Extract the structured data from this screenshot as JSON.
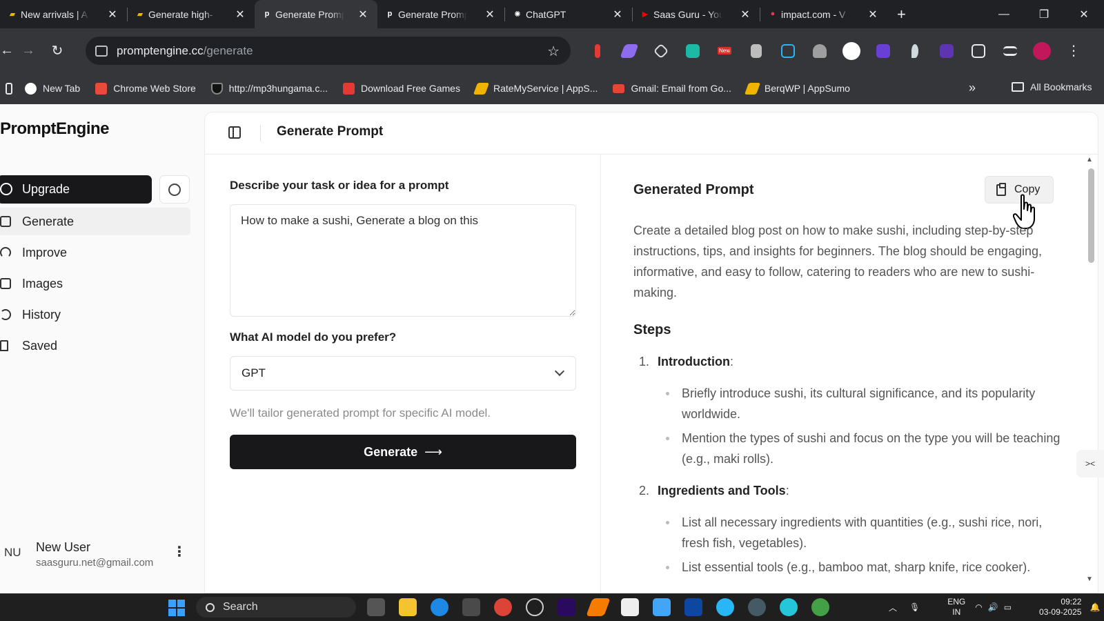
{
  "browser": {
    "tabs": [
      {
        "title": "New arrivals | A",
        "favicon": "aws-icon",
        "color": "#f0b400"
      },
      {
        "title": "Generate high-",
        "favicon": "appsumo-icon",
        "color": "#f0b400"
      },
      {
        "title": "Generate Promp",
        "favicon": "p",
        "active": true
      },
      {
        "title": "Generate Promp",
        "favicon": "p"
      },
      {
        "title": "ChatGPT",
        "favicon": "openai-icon"
      },
      {
        "title": "Saas Guru - You",
        "favicon": "youtube-icon",
        "color": "#ff0000"
      },
      {
        "title": "impact.com - V",
        "favicon": "impact-icon",
        "color": "#e53950"
      }
    ],
    "url_host": "promptengine.cc",
    "url_path": "/generate",
    "ext_new_badge": "New",
    "bookmarks": [
      {
        "label": "New Tab",
        "color": "#ffffff"
      },
      {
        "label": "Chrome Web Store",
        "color": "#e84a3c"
      },
      {
        "label": "http://mp3hungama.c...",
        "color": "#111111"
      },
      {
        "label": "Download Free Games",
        "color": "#e53935"
      },
      {
        "label": "RateMyService | AppS...",
        "color": "#f0b400"
      },
      {
        "label": "Gmail: Email from Go...",
        "color": "#ea4335"
      },
      {
        "label": "BerqWP | AppSumo",
        "color": "#f0b400"
      }
    ],
    "all_bookmarks": "All Bookmarks"
  },
  "sidebar": {
    "logo": "PromptEngine",
    "upgrade": "Upgrade",
    "items": [
      {
        "label": "Generate",
        "icon": "square-chevron-icon",
        "active": true
      },
      {
        "label": "Improve",
        "icon": "gauge-icon"
      },
      {
        "label": "Images",
        "icon": "image-icon"
      },
      {
        "label": "History",
        "icon": "history-icon"
      },
      {
        "label": "Saved",
        "icon": "bookmark-icon"
      }
    ],
    "user": {
      "initials": "NU",
      "name": "New User",
      "email": "saasguru.net@gmail.com"
    }
  },
  "header": {
    "title": "Generate Prompt"
  },
  "form": {
    "task_label": "Describe your task or idea for a prompt",
    "task_value": "How to make a sushi, Generate a blog on this",
    "model_label": "What AI model do you prefer?",
    "model_value": "GPT",
    "hint": "We'll tailor generated prompt for specific AI model.",
    "generate": "Generate"
  },
  "output": {
    "title": "Generated Prompt",
    "copy": "Copy",
    "intro": "Create a detailed blog post on how to make sushi, including step-by-step instructions, tips, and insights for beginners. The blog should be engaging, informative, and easy to follow, catering to readers who are new to sushi-making.",
    "steps_heading": "Steps",
    "steps": [
      {
        "num": "1.",
        "title": "Introduction",
        "bullets": [
          "Briefly introduce sushi, its cultural significance, and its popularity worldwide.",
          "Mention the types of sushi and focus on the type you will be teaching (e.g., maki rolls)."
        ]
      },
      {
        "num": "2.",
        "title": "Ingredients and Tools",
        "bullets": [
          "List all necessary ingredients with quantities (e.g., sushi rice, nori, fresh fish, vegetables).",
          "List essential tools (e.g., bamboo mat, sharp knife, rice cooker)."
        ]
      }
    ]
  },
  "taskbar": {
    "search": "Search",
    "lang_top": "ENG",
    "lang_bottom": "IN",
    "time": "09:22",
    "date": "03-09-2025"
  },
  "colors": {
    "accent": "#18181b",
    "windows_blue": "#3aa0ff"
  }
}
